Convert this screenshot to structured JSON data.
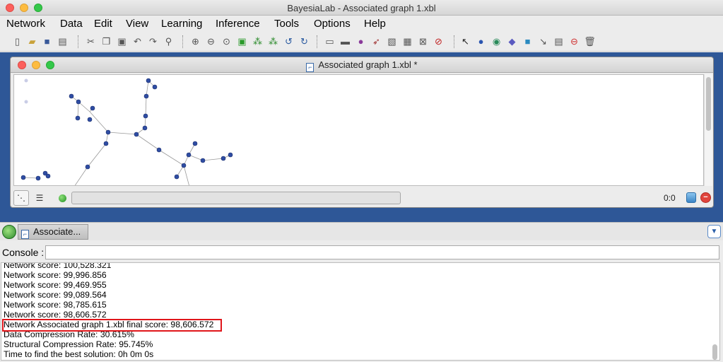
{
  "window": {
    "title": "BayesiaLab - Associated graph 1.xbl"
  },
  "menu": [
    "Network",
    "Data",
    "Edit",
    "View",
    "Learning",
    "Inference",
    "Tools",
    "Options",
    "Help"
  ],
  "inner_window": {
    "title": "Associated graph 1.xbl *"
  },
  "status": {
    "ratio": "0:0"
  },
  "task_tab": {
    "label": "Associate..."
  },
  "console": {
    "label": "Console :"
  },
  "log": {
    "lines": [
      "Network score: 100,528.321",
      "Network score: 99,996.856",
      "Network score: 99,469.955",
      "Network score: 99,089.564",
      "Network score: 98,785.615",
      "Network score: 98,606.572",
      "Network Associated graph 1.xbl final score: 98,606.572",
      "Data Compression Rate: 30.615%",
      "Structural Compression Rate: 95.745%",
      "Time to find the best solution: 0h 0m 0s"
    ],
    "highlighted_index": 6
  },
  "colors": {
    "desktop": "#2e5797",
    "highlight": "#e0161b",
    "node": "#2f4da3"
  }
}
